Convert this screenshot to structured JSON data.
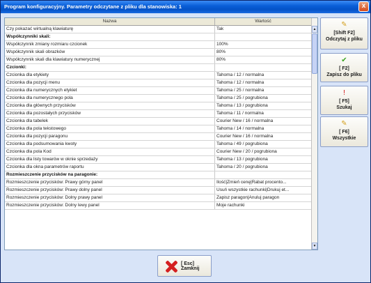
{
  "window": {
    "title": "Program konfiguracyjny. Parametry odczytane z pliku dla stanowiska: 1",
    "close_glyph": "x"
  },
  "table": {
    "columns": [
      "Nazwa",
      "Wartość"
    ],
    "rows": [
      {
        "name": "Czy pokazać wirtualną klawiaturę",
        "value": "Tak",
        "section": false
      },
      {
        "name": "Współczynniki skali:",
        "value": "",
        "section": true
      },
      {
        "name": "Współczynnik zmiany rozmiaru czcionek",
        "value": "100%",
        "section": false
      },
      {
        "name": "Współczynnik skali obrazków",
        "value": "80%",
        "section": false
      },
      {
        "name": "Współczynnik skali dla klawiatury numerycznej",
        "value": "80%",
        "section": false
      },
      {
        "name": "Czcionki:",
        "value": "",
        "section": true
      },
      {
        "name": "Czcionka dla etykiety",
        "value": "Tahoma / 12 / normalna",
        "section": false
      },
      {
        "name": "Czcionka dla pozycji menu",
        "value": "Tahoma / 12 / normalna",
        "section": false
      },
      {
        "name": "Czcionka dla numerycznych etykiet",
        "value": "Tahoma / 25 / normalna",
        "section": false
      },
      {
        "name": "Czcionka dla numerycznego pola",
        "value": "Tahoma / 25 / pogrubiona",
        "section": false
      },
      {
        "name": "Czcionka dla głównych przycisków",
        "value": "Tahoma / 13 / pogrubiona",
        "section": false
      },
      {
        "name": "Czcionka dla pozostałych przycisków",
        "value": "Tahoma / 11 / normalna",
        "section": false
      },
      {
        "name": "Czcionka dla tabelek",
        "value": "Courier New / 16 / normalna",
        "section": false
      },
      {
        "name": "Czcionka dla pola tekstowego",
        "value": "Tahoma / 14 / normalna",
        "section": false
      },
      {
        "name": "Czcionka dla pozycji paragonu",
        "value": "Courier New / 16 / normalna",
        "section": false
      },
      {
        "name": "Czcionka dla podsumowania kwoty",
        "value": "Tahoma / 49 / pogrubiona",
        "section": false
      },
      {
        "name": "Czcionka dla pola Kod",
        "value": "Courier New / 20 / pogrubiona",
        "section": false
      },
      {
        "name": "Czcionka dla listy towarów w oknie sprzedaży",
        "value": "Tahoma / 13 / pogrubiona",
        "section": false
      },
      {
        "name": "Czcionka dla okna parametrów raportu",
        "value": "Tahoma / 20 / pogrubiona",
        "section": false
      },
      {
        "name": "Rozmieszczenie przycisków na paragonie:",
        "value": "",
        "section": true
      },
      {
        "name": "Rozmieszczenie przycisków: Prawy górny panel",
        "value": "Ilość|Zmień cenę|Rabat procento...",
        "section": false
      },
      {
        "name": "Rozmieszczenie przycisków: Prawy dolny panel",
        "value": "Usuń wszystkie rachunki|Drukuj et...",
        "section": false
      },
      {
        "name": "Rozmieszczenie przycisków: Dolny prawy panel",
        "value": "Zapisz paragon|Anuluj paragon",
        "section": false
      },
      {
        "name": "Rozmieszczenie przycisków: Dolny lewy panel",
        "value": "Moje rachunki",
        "section": false
      }
    ]
  },
  "scroll": {
    "up_glyph": "▲",
    "down_glyph": "▼"
  },
  "side_buttons": [
    {
      "key": "[Shift F2]",
      "label": "Odczytaj z pliku",
      "icon": "pencil-icon"
    },
    {
      "key": "[ F2]",
      "label": "Zapisz do pliku",
      "icon": "check-icon"
    },
    {
      "key": "[ F5]",
      "label": "Szukaj",
      "icon": "exclamation-icon"
    },
    {
      "key": "[ F6]",
      "label": "Wszystkie",
      "icon": "pencil-icon"
    }
  ],
  "close_button": {
    "label": "[ Esc] Zamknij"
  }
}
